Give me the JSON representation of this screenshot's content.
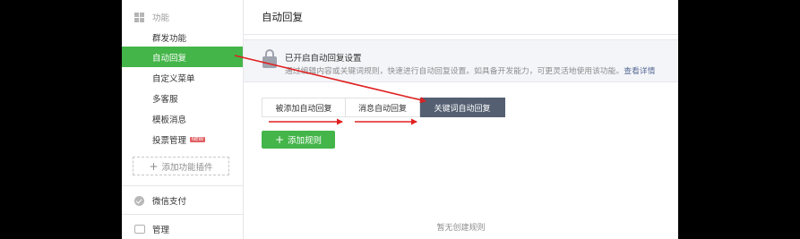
{
  "sidebar": {
    "group_title": "功能",
    "items": [
      {
        "label": "群发功能",
        "active": false
      },
      {
        "label": "自动回复",
        "active": true
      },
      {
        "label": "自定义菜单",
        "active": false
      },
      {
        "label": "多客服",
        "active": false
      },
      {
        "label": "模板消息",
        "active": false
      },
      {
        "label": "投票管理",
        "active": false,
        "badge": "NEW"
      }
    ],
    "add_plugin": "添加功能插件",
    "sections": [
      {
        "label": "微信支付",
        "icon": "check-circle-icon"
      },
      {
        "label": "管理",
        "icon": "tray-icon"
      }
    ]
  },
  "main": {
    "title": "自动回复",
    "notice": {
      "title": "已开启自动回复设置",
      "desc": "通过编辑内容或关键词规则，快速进行自动回复设置。如具备开发能力，可更灵活地使用该功能。",
      "link": "查看详情"
    },
    "tabs": [
      {
        "label": "被添加自动回复",
        "active": false
      },
      {
        "label": "消息自动回复",
        "active": false
      },
      {
        "label": "关键词自动回复",
        "active": true
      }
    ],
    "add_rule": "添加规则",
    "empty": "暂无创建规则"
  },
  "colors": {
    "accent_green": "#44b549",
    "active_tab": "#545f71",
    "annotation_arrow": "#e02020"
  }
}
